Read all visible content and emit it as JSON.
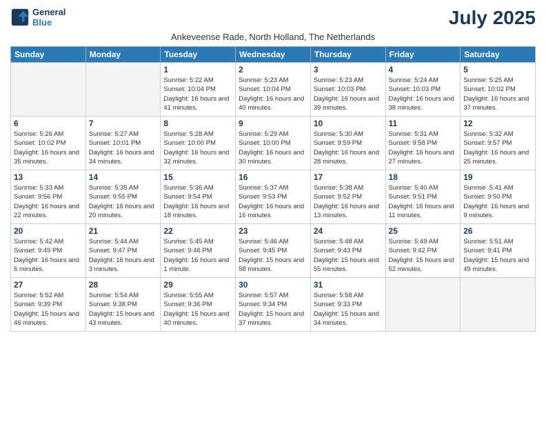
{
  "logo": {
    "line1": "General",
    "line2": "Blue"
  },
  "title": "July 2025",
  "subtitle": "Ankeveense Rade, North Holland, The Netherlands",
  "headers": [
    "Sunday",
    "Monday",
    "Tuesday",
    "Wednesday",
    "Thursday",
    "Friday",
    "Saturday"
  ],
  "weeks": [
    [
      {
        "day": "",
        "empty": true
      },
      {
        "day": "",
        "empty": true
      },
      {
        "day": "1",
        "sunrise": "Sunrise: 5:22 AM",
        "sunset": "Sunset: 10:04 PM",
        "daylight": "Daylight: 16 hours and 41 minutes."
      },
      {
        "day": "2",
        "sunrise": "Sunrise: 5:23 AM",
        "sunset": "Sunset: 10:04 PM",
        "daylight": "Daylight: 16 hours and 40 minutes."
      },
      {
        "day": "3",
        "sunrise": "Sunrise: 5:23 AM",
        "sunset": "Sunset: 10:03 PM",
        "daylight": "Daylight: 16 hours and 39 minutes."
      },
      {
        "day": "4",
        "sunrise": "Sunrise: 5:24 AM",
        "sunset": "Sunset: 10:03 PM",
        "daylight": "Daylight: 16 hours and 38 minutes."
      },
      {
        "day": "5",
        "sunrise": "Sunrise: 5:25 AM",
        "sunset": "Sunset: 10:02 PM",
        "daylight": "Daylight: 16 hours and 37 minutes."
      }
    ],
    [
      {
        "day": "6",
        "sunrise": "Sunrise: 5:26 AM",
        "sunset": "Sunset: 10:02 PM",
        "daylight": "Daylight: 16 hours and 35 minutes."
      },
      {
        "day": "7",
        "sunrise": "Sunrise: 5:27 AM",
        "sunset": "Sunset: 10:01 PM",
        "daylight": "Daylight: 16 hours and 34 minutes."
      },
      {
        "day": "8",
        "sunrise": "Sunrise: 5:28 AM",
        "sunset": "Sunset: 10:00 PM",
        "daylight": "Daylight: 16 hours and 32 minutes."
      },
      {
        "day": "9",
        "sunrise": "Sunrise: 5:29 AM",
        "sunset": "Sunset: 10:00 PM",
        "daylight": "Daylight: 16 hours and 30 minutes."
      },
      {
        "day": "10",
        "sunrise": "Sunrise: 5:30 AM",
        "sunset": "Sunset: 9:59 PM",
        "daylight": "Daylight: 16 hours and 28 minutes."
      },
      {
        "day": "11",
        "sunrise": "Sunrise: 5:31 AM",
        "sunset": "Sunset: 9:58 PM",
        "daylight": "Daylight: 16 hours and 27 minutes."
      },
      {
        "day": "12",
        "sunrise": "Sunrise: 5:32 AM",
        "sunset": "Sunset: 9:57 PM",
        "daylight": "Daylight: 16 hours and 25 minutes."
      }
    ],
    [
      {
        "day": "13",
        "sunrise": "Sunrise: 5:33 AM",
        "sunset": "Sunset: 9:56 PM",
        "daylight": "Daylight: 16 hours and 22 minutes."
      },
      {
        "day": "14",
        "sunrise": "Sunrise: 5:35 AM",
        "sunset": "Sunset: 9:55 PM",
        "daylight": "Daylight: 16 hours and 20 minutes."
      },
      {
        "day": "15",
        "sunrise": "Sunrise: 5:36 AM",
        "sunset": "Sunset: 9:54 PM",
        "daylight": "Daylight: 16 hours and 18 minutes."
      },
      {
        "day": "16",
        "sunrise": "Sunrise: 5:37 AM",
        "sunset": "Sunset: 9:53 PM",
        "daylight": "Daylight: 16 hours and 16 minutes."
      },
      {
        "day": "17",
        "sunrise": "Sunrise: 5:38 AM",
        "sunset": "Sunset: 9:52 PM",
        "daylight": "Daylight: 16 hours and 13 minutes."
      },
      {
        "day": "18",
        "sunrise": "Sunrise: 5:40 AM",
        "sunset": "Sunset: 9:51 PM",
        "daylight": "Daylight: 16 hours and 11 minutes."
      },
      {
        "day": "19",
        "sunrise": "Sunrise: 5:41 AM",
        "sunset": "Sunset: 9:50 PM",
        "daylight": "Daylight: 16 hours and 9 minutes."
      }
    ],
    [
      {
        "day": "20",
        "sunrise": "Sunrise: 5:42 AM",
        "sunset": "Sunset: 9:49 PM",
        "daylight": "Daylight: 16 hours and 6 minutes."
      },
      {
        "day": "21",
        "sunrise": "Sunrise: 5:44 AM",
        "sunset": "Sunset: 9:47 PM",
        "daylight": "Daylight: 16 hours and 3 minutes."
      },
      {
        "day": "22",
        "sunrise": "Sunrise: 5:45 AM",
        "sunset": "Sunset: 9:46 PM",
        "daylight": "Daylight: 16 hours and 1 minute."
      },
      {
        "day": "23",
        "sunrise": "Sunrise: 5:46 AM",
        "sunset": "Sunset: 9:45 PM",
        "daylight": "Daylight: 15 hours and 58 minutes."
      },
      {
        "day": "24",
        "sunrise": "Sunrise: 5:48 AM",
        "sunset": "Sunset: 9:43 PM",
        "daylight": "Daylight: 15 hours and 55 minutes."
      },
      {
        "day": "25",
        "sunrise": "Sunrise: 5:49 AM",
        "sunset": "Sunset: 9:42 PM",
        "daylight": "Daylight: 15 hours and 52 minutes."
      },
      {
        "day": "26",
        "sunrise": "Sunrise: 5:51 AM",
        "sunset": "Sunset: 9:41 PM",
        "daylight": "Daylight: 15 hours and 49 minutes."
      }
    ],
    [
      {
        "day": "27",
        "sunrise": "Sunrise: 5:52 AM",
        "sunset": "Sunset: 9:39 PM",
        "daylight": "Daylight: 15 hours and 46 minutes."
      },
      {
        "day": "28",
        "sunrise": "Sunrise: 5:54 AM",
        "sunset": "Sunset: 9:38 PM",
        "daylight": "Daylight: 15 hours and 43 minutes."
      },
      {
        "day": "29",
        "sunrise": "Sunrise: 5:55 AM",
        "sunset": "Sunset: 9:36 PM",
        "daylight": "Daylight: 15 hours and 40 minutes."
      },
      {
        "day": "30",
        "sunrise": "Sunrise: 5:57 AM",
        "sunset": "Sunset: 9:34 PM",
        "daylight": "Daylight: 15 hours and 37 minutes."
      },
      {
        "day": "31",
        "sunrise": "Sunrise: 5:58 AM",
        "sunset": "Sunset: 9:33 PM",
        "daylight": "Daylight: 15 hours and 34 minutes."
      },
      {
        "day": "",
        "empty": true
      },
      {
        "day": "",
        "empty": true
      }
    ]
  ]
}
